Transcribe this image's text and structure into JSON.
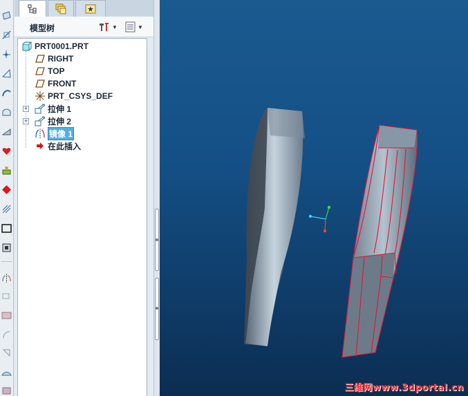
{
  "navigator": {
    "tabs": [
      "model-tree",
      "folder-browser",
      "favorites"
    ],
    "tree_title": "模型树"
  },
  "tree": {
    "root": "PRT0001.PRT",
    "items": [
      {
        "label": "RIGHT",
        "icon": "datum-plane-icon"
      },
      {
        "label": "TOP",
        "icon": "datum-plane-icon"
      },
      {
        "label": "FRONT",
        "icon": "datum-plane-icon"
      },
      {
        "label": "PRT_CSYS_DEF",
        "icon": "coordinate-system-icon"
      },
      {
        "label": "拉伸 1",
        "icon": "extrude-icon",
        "expandable": true
      },
      {
        "label": "拉伸 2",
        "icon": "extrude-icon",
        "expandable": true
      },
      {
        "label": "镜像 1",
        "icon": "mirror-icon",
        "selected": true
      },
      {
        "label": "在此插入",
        "icon": "insert-here-arrow-icon"
      }
    ]
  },
  "viewport": {
    "watermark": "三维网www.3dportal.cn",
    "colors": {
      "background_top": "#1a5a8f",
      "background_bottom": "#0b2d52",
      "part_face": "#6f7f8e",
      "highlight_edges": "#e0153a"
    }
  }
}
